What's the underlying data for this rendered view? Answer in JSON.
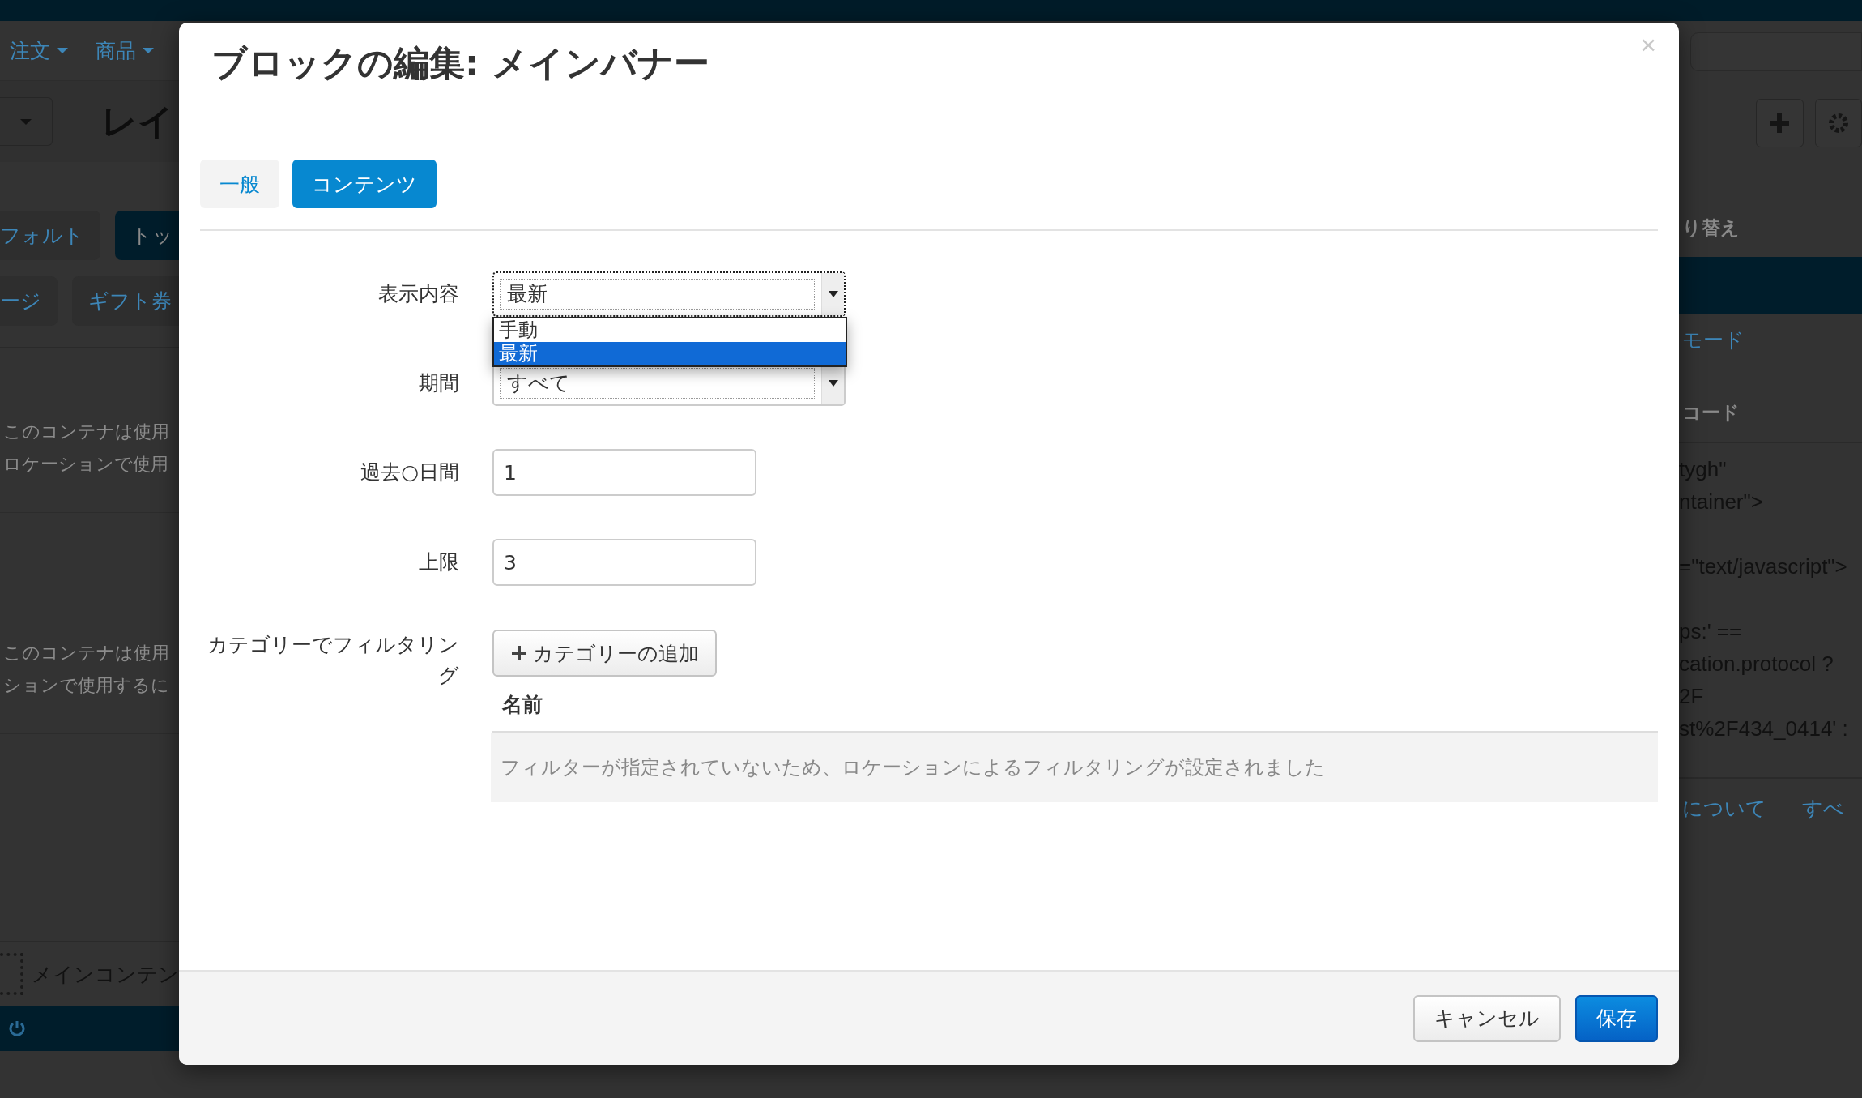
{
  "background": {
    "nav": [
      {
        "label": "注文"
      },
      {
        "label": "商品"
      }
    ],
    "page_title": "レイ",
    "location_tabs": [
      {
        "label": "フォルト",
        "selected": false
      },
      {
        "label": "トッ",
        "selected": true
      }
    ],
    "location_tabs_2": [
      {
        "label": "ージ",
        "selected": false
      },
      {
        "label": "ギフト券",
        "selected": false
      }
    ],
    "notes": [
      [
        "このコンテナは使用",
        "ロケーションで使用"
      ],
      [
        "このコンテナは使用",
        "ションで使用するに"
      ]
    ],
    "main_container": "メインコンテン",
    "side": {
      "switch_label": "り替え",
      "mode_link": "モード",
      "code_label": "コード",
      "code_blocks": [
        [
          "tygh\"",
          "ntainer\">"
        ],
        [
          "=\"text/javascript\">"
        ],
        [
          "ps:' ==",
          "cation.protocol ?",
          "2F",
          "st%2F434_0414' :"
        ]
      ],
      "links": [
        "について",
        "すべ"
      ]
    }
  },
  "dialog": {
    "title": "ブロックの編集: メインバナー",
    "close": "×",
    "tabs": [
      {
        "label": "一般",
        "selected": false
      },
      {
        "label": "コンテンツ",
        "selected": true
      }
    ],
    "fields": [
      {
        "kind": "select",
        "label": "表示内容",
        "value": "最新",
        "open": true,
        "options": [
          {
            "label": "手動",
            "selected": false
          },
          {
            "label": "最新",
            "selected": true
          }
        ]
      },
      {
        "kind": "select",
        "label": "期間",
        "value": "すべて",
        "open": false
      },
      {
        "kind": "input",
        "label": "過去○日間",
        "value": "1"
      },
      {
        "kind": "input",
        "label": "上限",
        "value": "3"
      }
    ],
    "category_filter": {
      "label": "カテゴリーでフィルタリング",
      "add_button": "カテゴリーの追加",
      "column": "名前",
      "empty_message": "フィルターが指定されていないため、ロケーションによるフィルタリングが設定されました"
    },
    "buttons": [
      {
        "label": "キャンセル",
        "kind": "default"
      },
      {
        "label": "保存",
        "kind": "primary"
      }
    ]
  }
}
